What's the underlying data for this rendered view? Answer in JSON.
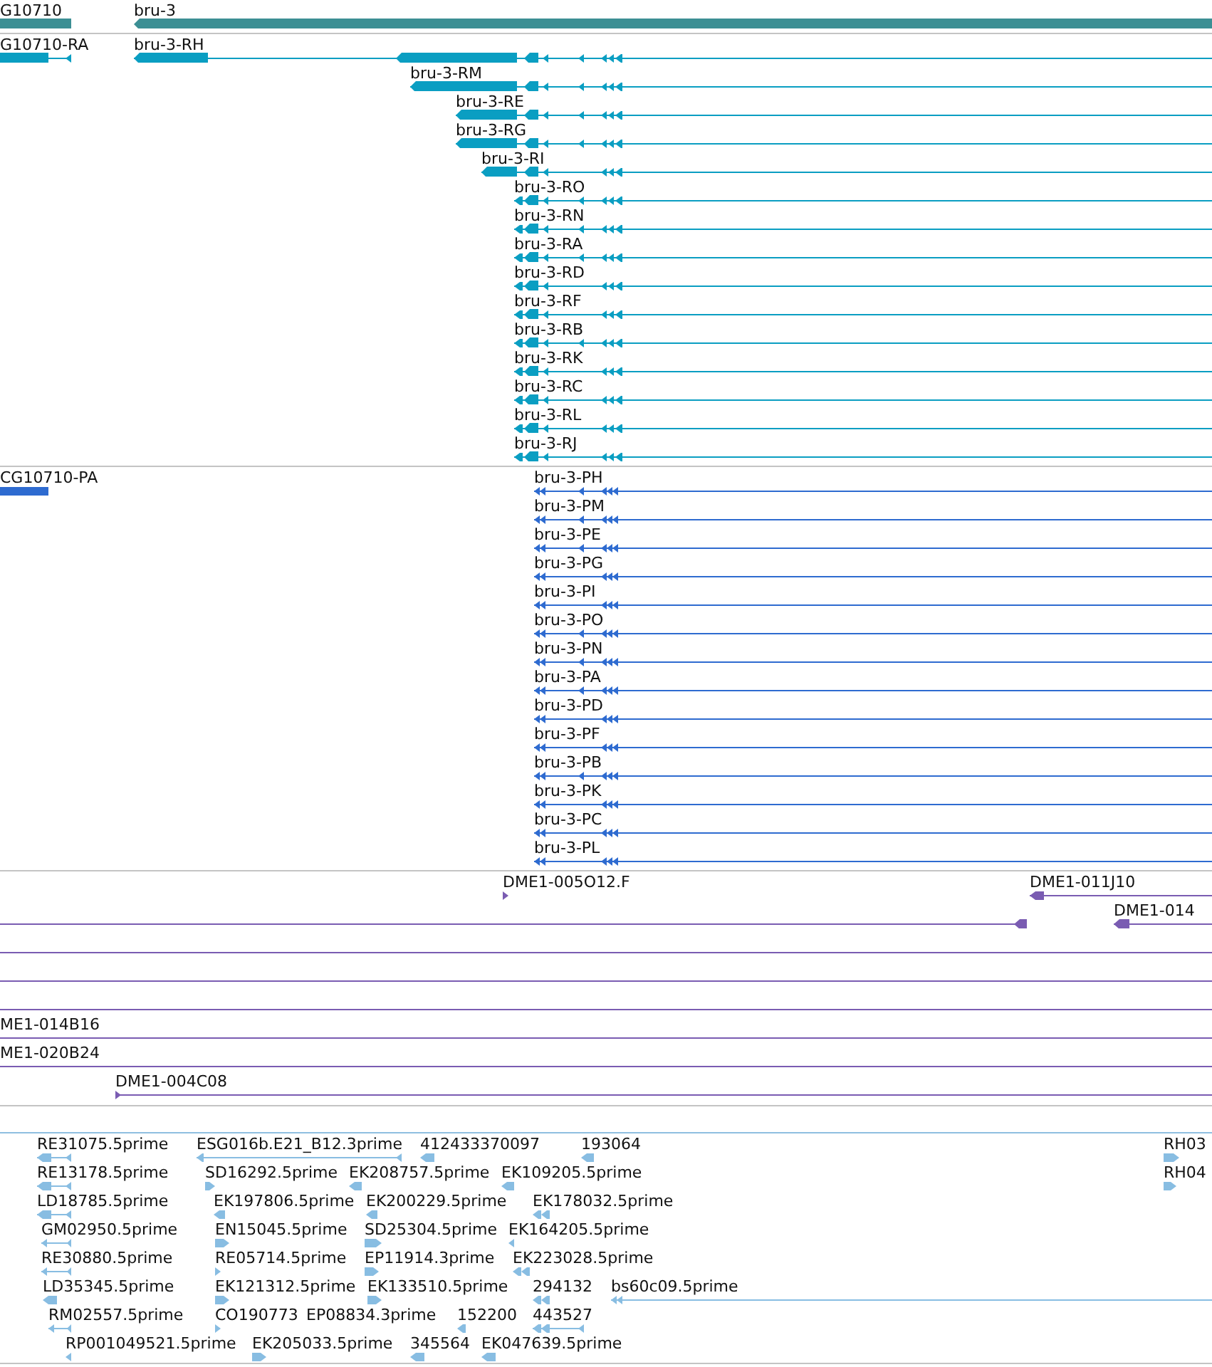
{
  "tracks": [
    {
      "kind": "gene",
      "color": "#3c8f94",
      "features": [
        {
          "label": "G10710"
        },
        {
          "label": "bru-3"
        }
      ]
    },
    {
      "kind": "transcript",
      "color": "#0a9ec2",
      "features": [
        {
          "label": "G10710-RA"
        },
        {
          "label": "bru-3-RH"
        },
        {
          "label": "bru-3-RM"
        },
        {
          "label": "bru-3-RE"
        },
        {
          "label": "bru-3-RG"
        },
        {
          "label": "bru-3-RI"
        },
        {
          "label": "bru-3-RO"
        },
        {
          "label": "bru-3-RN"
        },
        {
          "label": "bru-3-RA"
        },
        {
          "label": "bru-3-RD"
        },
        {
          "label": "bru-3-RF"
        },
        {
          "label": "bru-3-RB"
        },
        {
          "label": "bru-3-RK"
        },
        {
          "label": "bru-3-RC"
        },
        {
          "label": "bru-3-RL"
        },
        {
          "label": "bru-3-RJ"
        }
      ]
    },
    {
      "kind": "protein",
      "color": "#2e6bd0",
      "features": [
        {
          "label": "CG10710-PA"
        },
        {
          "label": "bru-3-PH"
        },
        {
          "label": "bru-3-PM"
        },
        {
          "label": "bru-3-PE"
        },
        {
          "label": "bru-3-PG"
        },
        {
          "label": "bru-3-PI"
        },
        {
          "label": "bru-3-PO"
        },
        {
          "label": "bru-3-PN"
        },
        {
          "label": "bru-3-PA"
        },
        {
          "label": "bru-3-PD"
        },
        {
          "label": "bru-3-PF"
        },
        {
          "label": "bru-3-PB"
        },
        {
          "label": "bru-3-PK"
        },
        {
          "label": "bru-3-PC"
        },
        {
          "label": "bru-3-PL"
        }
      ]
    },
    {
      "kind": "clone",
      "color": "#7a5cb2",
      "features": [
        {
          "label": "DME1-005O12.F"
        },
        {
          "label": "DME1-011J10"
        },
        {
          "label": "DME1-014"
        },
        {
          "label": "ME1-014B16"
        },
        {
          "label": "ME1-020B24"
        },
        {
          "label": "DME1-004C08"
        }
      ]
    },
    {
      "kind": "est",
      "color": "#88bde2",
      "features": [
        {
          "label": "RE31075.5prime"
        },
        {
          "label": "ESG016b.E21_B12.3prime"
        },
        {
          "label": "412433370097"
        },
        {
          "label": "193064"
        },
        {
          "label": "RH03"
        },
        {
          "label": "RE13178.5prime"
        },
        {
          "label": "SD16292.5prime"
        },
        {
          "label": "EK208757.5prime"
        },
        {
          "label": "EK109205.5prime"
        },
        {
          "label": "RH04"
        },
        {
          "label": "LD18785.5prime"
        },
        {
          "label": "EK197806.5prime"
        },
        {
          "label": "EK200229.5prime"
        },
        {
          "label": "EK178032.5prime"
        },
        {
          "label": "GM02950.5prime"
        },
        {
          "label": "EN15045.5prime"
        },
        {
          "label": "SD25304.5prime"
        },
        {
          "label": "EK164205.5prime"
        },
        {
          "label": "RE30880.5prime"
        },
        {
          "label": "RE05714.5prime"
        },
        {
          "label": "EP11914.3prime"
        },
        {
          "label": "EK223028.5prime"
        },
        {
          "label": "LD35345.5prime"
        },
        {
          "label": "EK121312.5prime"
        },
        {
          "label": "EK133510.5prime"
        },
        {
          "label": "294132"
        },
        {
          "label": "bs60c09.5prime"
        },
        {
          "label": "RM02557.5prime"
        },
        {
          "label": "CO190773"
        },
        {
          "label": "EP08834.3prime"
        },
        {
          "label": "152200"
        },
        {
          "label": "443527"
        },
        {
          "label": "RP001049521.5prime"
        },
        {
          "label": "EK205033.5prime"
        },
        {
          "label": "345564"
        },
        {
          "label": "EK047639.5prime"
        }
      ]
    }
  ]
}
